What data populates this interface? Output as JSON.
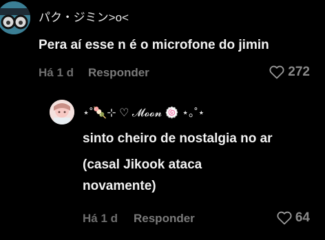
{
  "comment": {
    "username": "パク・ジミン>o<",
    "text": "Pera aí esse n é o microfone do jimin",
    "time": "Há 1 d",
    "reply_label": "Responder",
    "likes": "272",
    "avatar_icon": "cartoon-avatar-icon"
  },
  "reply": {
    "username": "⋆˚🍡⊹ ♡ 𝓜𝓸𝓸𝓷 🍥 ⋆｡˚⋆",
    "text_lines": [
      "sinto cheiro de nostalgia no ar",
      "(casal Jikook ataca",
      "novamente)"
    ],
    "time": "Há 1 d",
    "reply_label": "Responder",
    "likes": "64",
    "avatar_icon": "pastel-avatar-icon"
  },
  "colors": {
    "background": "#000000",
    "text": "#f2f2f2",
    "muted": "#7a7a7a"
  }
}
